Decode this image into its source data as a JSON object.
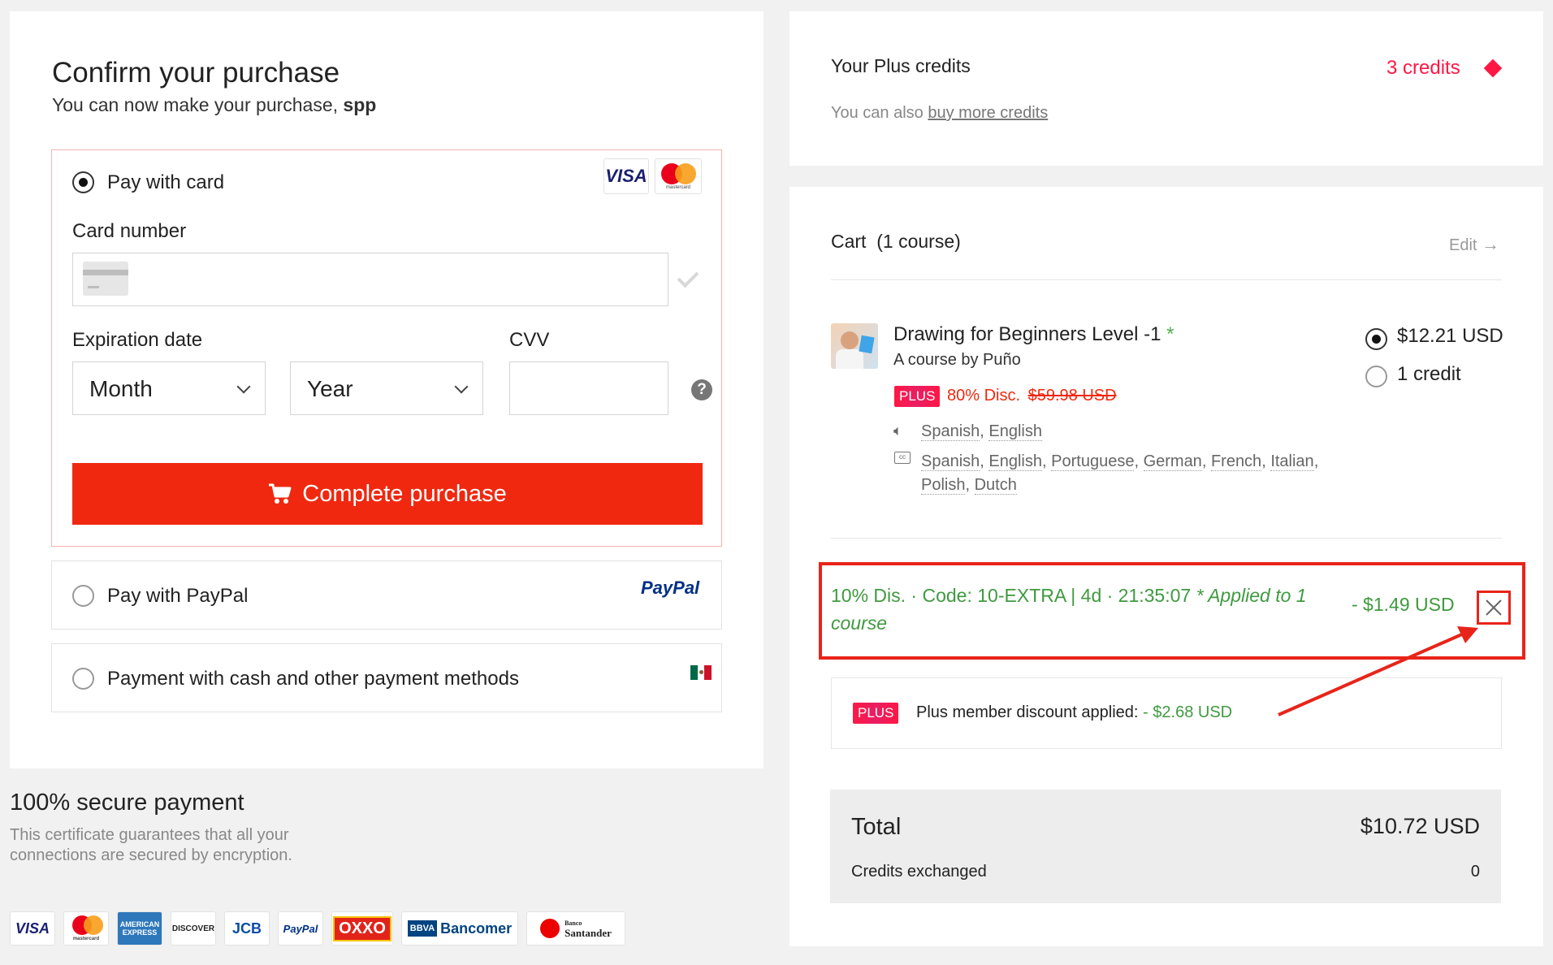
{
  "purchase": {
    "title": "Confirm your purchase",
    "subtitle_prefix": "You can now make your purchase, ",
    "username": "spp"
  },
  "payment": {
    "card": {
      "label": "Pay with card",
      "card_number_label": "Card number",
      "expiration_label": "Expiration date",
      "cvv_label": "CVV",
      "month_value": "Month",
      "year_value": "Year",
      "complete_button": "Complete purchase",
      "visa_text": "VISA",
      "mastercard_text": "mastercard"
    },
    "paypal": {
      "label": "Pay with PayPal",
      "logo_text": "PayPal"
    },
    "cash": {
      "label": "Payment with cash and other payment methods"
    }
  },
  "secure": {
    "title": "100% secure payment",
    "text_line1": "This certificate guarantees that all your",
    "text_line2": "connections are secured by encryption.",
    "logos": [
      "VISA",
      "mastercard",
      "AMERICAN EXPRESS",
      "DISCOVER",
      "JCB",
      "PayPal",
      "OXXO",
      "Bancomer",
      "Santander"
    ],
    "bbva_text": "BBVA",
    "banco_text": "Banco"
  },
  "credits": {
    "title": "Your Plus credits",
    "count": "3 credits",
    "buy_prefix": "You can also ",
    "buy_link": "buy more credits"
  },
  "cart": {
    "title": "Cart  (1 course)",
    "edit": "Edit",
    "course": {
      "name": "Drawing for Beginners Level -1",
      "asterisk": "*",
      "author": "A course by Puño",
      "plus_badge": "PLUS",
      "discount": "80% Disc.",
      "original_price": "$59.98 USD",
      "audio": [
        "Spanish",
        "English"
      ],
      "subtitles_line1": [
        "Spanish",
        "English",
        "Portuguese",
        "German",
        "French",
        "Italian"
      ],
      "subtitles_line2": [
        "Polish",
        "Dutch"
      ],
      "price_option": "$12.21 USD",
      "credit_option": "1 credit"
    },
    "coupon": {
      "text": "10% Dis. · Code: 10-EXTRA | 4d · 21:35:07",
      "applied_text": "* Applied to",
      "applied_text2": "1 course",
      "amount": "- $1.49 USD"
    },
    "plus_discount": {
      "badge": "PLUS",
      "label": "Plus member discount applied:",
      "amount": "- $2.68 USD"
    },
    "total": {
      "label": "Total",
      "value": "$10.72 USD",
      "credits_label": "Credits exchanged",
      "credits_value": "0"
    }
  },
  "colors": {
    "accent_red": "#f0280f",
    "discount_green": "#3f9a3f",
    "credits_pink": "#ff1744",
    "annotation_red": "#e8241a"
  }
}
